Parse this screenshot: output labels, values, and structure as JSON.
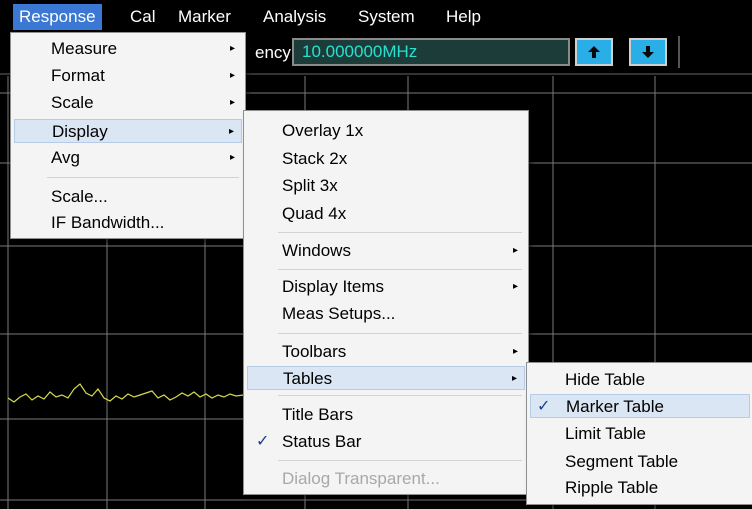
{
  "menubar": {
    "items": [
      "Response",
      "Cal",
      "Marker",
      "Analysis",
      "System",
      "Help"
    ],
    "active": "Response"
  },
  "toolbar": {
    "label": "ency",
    "frequency_value": "10.000000MHz"
  },
  "response_menu": {
    "items": [
      "Measure",
      "Format",
      "Scale",
      "Display",
      "Avg",
      "Scale...",
      "IF Bandwidth..."
    ],
    "highlighted": "Display"
  },
  "display_menu": {
    "items": [
      "Overlay 1x",
      "Stack 2x",
      "Split 3x",
      "Quad 4x",
      "Windows",
      "Display Items",
      "Meas Setups...",
      "Toolbars",
      "Tables",
      "Title Bars",
      "Status Bar",
      "Dialog Transparent..."
    ],
    "highlighted": "Tables",
    "checked": "Status Bar",
    "disabled": "Dialog Transparent..."
  },
  "tables_menu": {
    "items": [
      "Hide Table",
      "Marker Table",
      "Limit Table",
      "Segment Table",
      "Ripple Table"
    ],
    "highlighted": "Marker Table",
    "checked": "Marker Table"
  },
  "check_mark": "✓",
  "submenu_arrow": "▸",
  "colors": {
    "menu_highlight": "#3a78d4",
    "trace": "#d8d84a",
    "frequency_text": "#29e0d0",
    "arrow_button": "#2aaee8"
  }
}
